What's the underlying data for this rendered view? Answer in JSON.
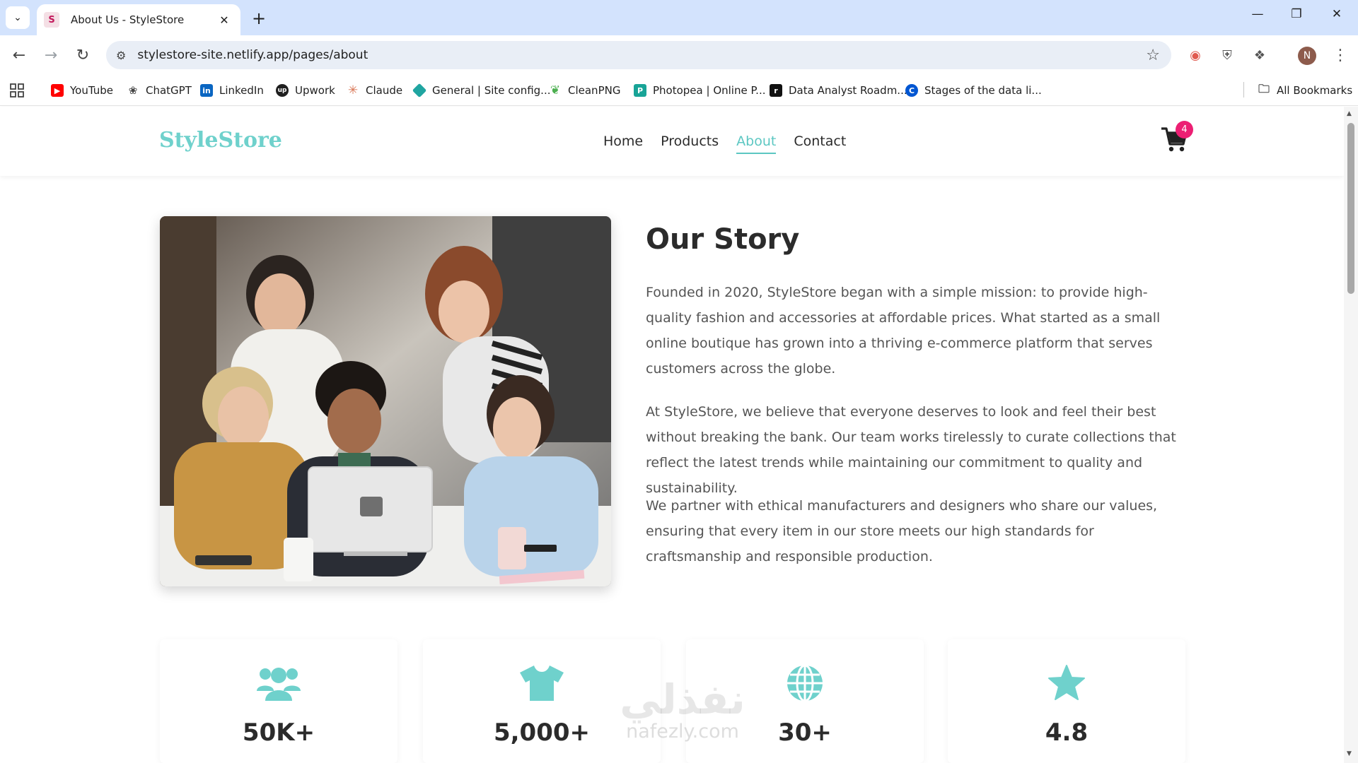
{
  "browser": {
    "tab_title": "About Us - StyleStore",
    "url": "stylestore-site.netlify.app/pages/about",
    "profile_initial": "N",
    "bookmarks": [
      {
        "label": "YouTube",
        "icon": "youtube-icon",
        "color": "#ff0000"
      },
      {
        "label": "ChatGPT",
        "icon": "chatgpt-icon",
        "color": "#444444"
      },
      {
        "label": "LinkedIn",
        "icon": "linkedin-icon",
        "color": "#0a66c2"
      },
      {
        "label": "Upwork",
        "icon": "upwork-icon",
        "color": "#1f1f1f"
      },
      {
        "label": "Claude",
        "icon": "claude-icon",
        "color": "#d97757"
      },
      {
        "label": "General | Site config...",
        "icon": "netlify-icon",
        "color": "#20a5a1"
      },
      {
        "label": "CleanPNG",
        "icon": "cleanpng-icon",
        "color": "#4caf50"
      },
      {
        "label": "Photopea | Online P...",
        "icon": "photopea-icon",
        "color": "#18a497"
      },
      {
        "label": "Data Analyst Roadm...",
        "icon": "roadmap-icon",
        "color": "#111111"
      },
      {
        "label": "Stages of the data li...",
        "icon": "coursera-icon",
        "color": "#0056d2"
      }
    ],
    "all_bookmarks": "All Bookmarks"
  },
  "site": {
    "logo": "StyleStore",
    "nav": [
      "Home",
      "Products",
      "About",
      "Contact"
    ],
    "active_nav": "About",
    "cart_count": "4",
    "accent_color": "#5cc7c2",
    "badge_color": "#ec1f73"
  },
  "story": {
    "title": "Our Story",
    "paragraphs": [
      "Founded in 2020, StyleStore began with a simple mission: to provide high-quality fashion and accessories at affordable prices. What started as a small online boutique has grown into a thriving e-commerce platform that serves customers across the globe.",
      "At StyleStore, we believe that everyone deserves to look and feel their best without breaking the bank. Our team works tirelessly to curate collections that reflect the latest trends while maintaining our commitment to quality and sustainability.",
      "We partner with ethical manufacturers and designers who share our values, ensuring that every item in our store meets our high standards for craftsmanship and responsible production."
    ]
  },
  "stats": [
    {
      "icon": "users-icon",
      "value": "50K+"
    },
    {
      "icon": "tshirt-icon",
      "value": "5,000+"
    },
    {
      "icon": "globe-icon",
      "value": "30+"
    },
    {
      "icon": "star-icon",
      "value": "4.8"
    }
  ],
  "watermark": {
    "arabic": "نفذلي",
    "latin": "nafezly.com"
  }
}
